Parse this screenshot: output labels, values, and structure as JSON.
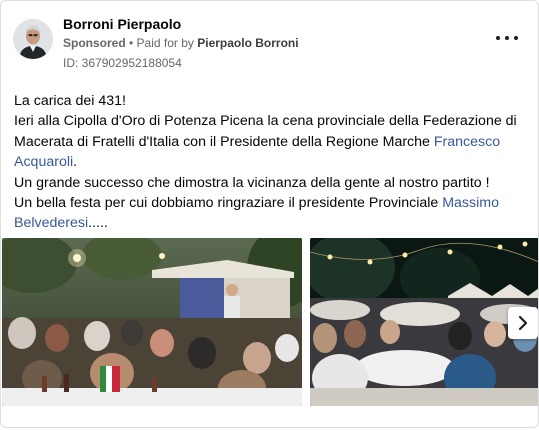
{
  "post": {
    "author_name": "Borroni Pierpaolo",
    "sponsored_label": "Sponsored",
    "separator": " • ",
    "paid_prefix": "Paid for by ",
    "paid_by": "Pierpaolo Borroni",
    "ad_id": "ID: 367902952188054",
    "more_options_icon": "three-dots-icon",
    "text": {
      "line1": "La carica dei 431!",
      "line2_part1": "Ieri alla Cipolla d'Oro di Potenza Picena la cena provinciale della Federazione di Macerata di Fratelli d'Italia con il Presidente della Regione Marche ",
      "line2_link": "Francesco Acquaroli",
      "line2_part2": ".",
      "line3": "Un grande successo che dimostra la vicinanza della gente al nostro partito !",
      "line4_part1": "Un bella festa per cui dobbiamo ringraziare il presidente Provinciale ",
      "line4_link": "Massimo Belvederesi",
      "line4_part2": "....."
    },
    "carousel": {
      "next_icon": "chevron-right-icon"
    }
  },
  "colors": {
    "link": "#385898",
    "secondary_text": "#65676b",
    "border": "#dddfe2"
  }
}
